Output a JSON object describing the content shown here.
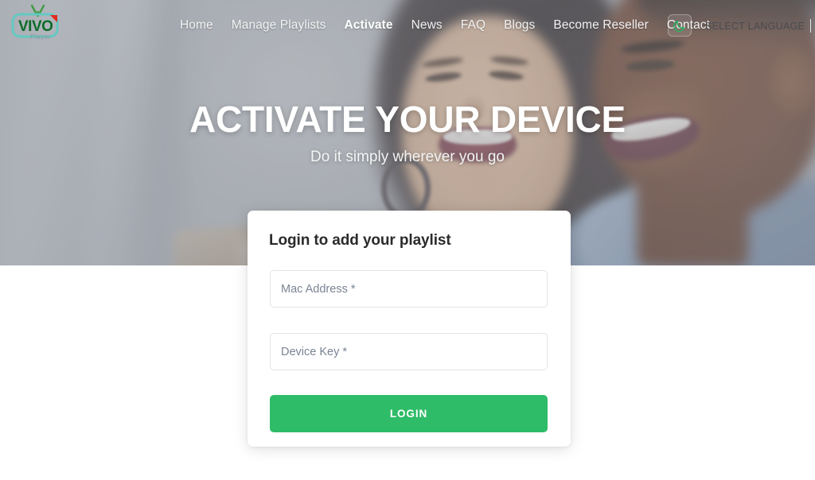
{
  "brand": {
    "logo_name": "vivo-player-logo",
    "title": "VIVO",
    "subtitle": "Player",
    "logo_green": "#0a6b2a",
    "logo_teal": "#5ec8c0",
    "logo_red": "#e02b20"
  },
  "nav": {
    "items": [
      {
        "label": "Home",
        "active": false
      },
      {
        "label": "Manage Playlists",
        "active": false
      },
      {
        "label": "Activate",
        "active": true
      },
      {
        "label": "News",
        "active": false
      },
      {
        "label": "FAQ",
        "active": false
      },
      {
        "label": "Blogs",
        "active": false
      },
      {
        "label": "Become Reseller",
        "active": false
      },
      {
        "label": "Contact",
        "active": false
      }
    ],
    "theme_toggle_icon": "moon-icon",
    "theme_toggle_color": "#22b95f",
    "language_label": "SELECT LANGUAGE"
  },
  "hero": {
    "title": "ACTIVATE YOUR DEVICE",
    "subtitle": "Do it simply wherever you go"
  },
  "login": {
    "title": "Login to add your playlist",
    "mac_placeholder": "Mac Address *",
    "mac_value": "",
    "key_placeholder": "Device Key *",
    "key_value": "",
    "button_label": "LOGIN",
    "button_color": "#2fbc68"
  }
}
